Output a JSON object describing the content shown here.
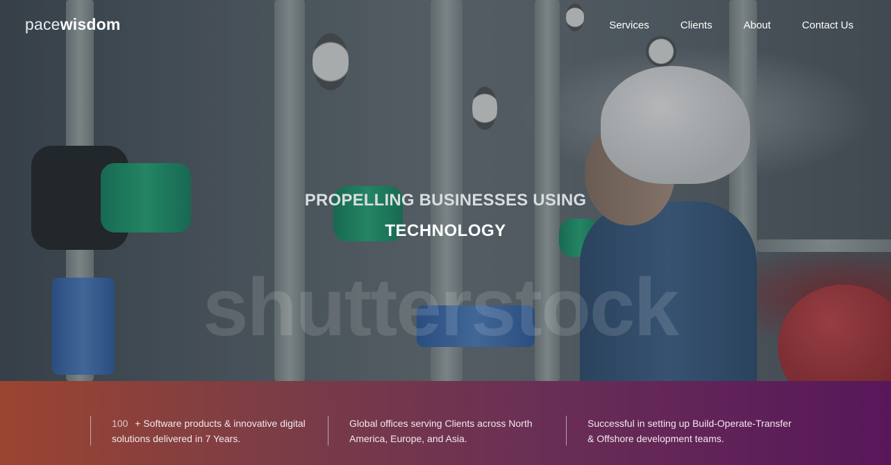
{
  "brand": {
    "logo_light": "pace",
    "logo_bold": "wisdom"
  },
  "nav": {
    "items": [
      {
        "label": "Services"
      },
      {
        "label": "Clients"
      },
      {
        "label": "About"
      },
      {
        "label": "Contact Us"
      }
    ]
  },
  "hero": {
    "line1": "PROPELLING BUSINESSES USING",
    "line2": "TECHNOLOGY",
    "watermark": "shutterstock"
  },
  "stats": [
    {
      "number": "100",
      "text": "+ Software products & innovative digital solutions delivered in 7 Years."
    },
    {
      "text": "Global offices serving Clients across North America, Europe, and Asia."
    },
    {
      "text": "Successful in setting up Build-Operate-Transfer & Offshore development teams."
    }
  ],
  "colors": {
    "stats_gradient_start": "#9b4431",
    "stats_gradient_end": "#57175a",
    "nav_text": "#ffffff"
  }
}
